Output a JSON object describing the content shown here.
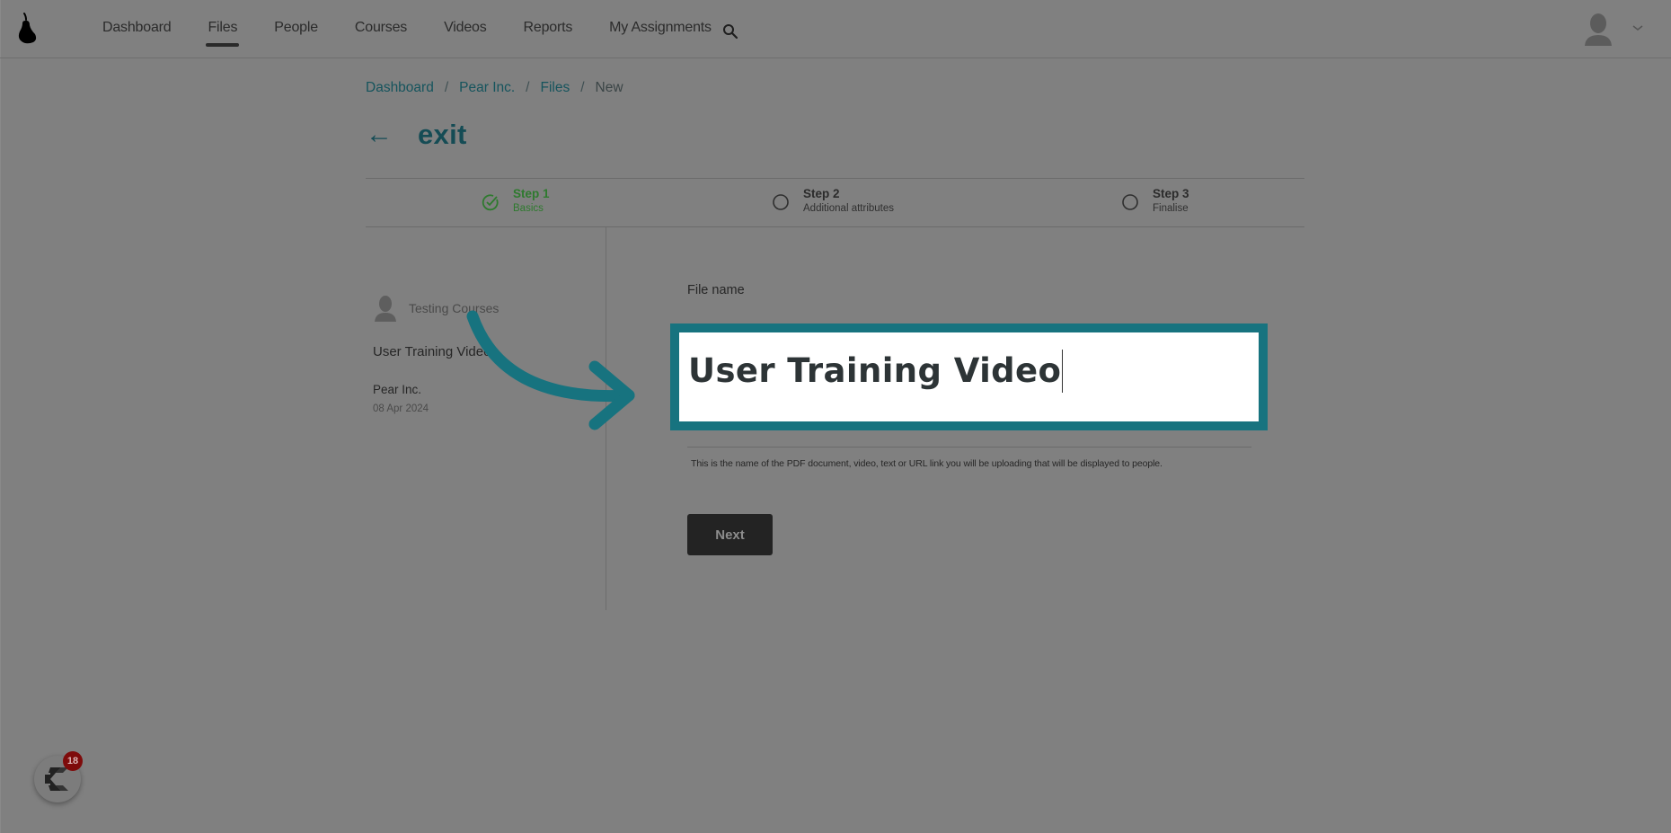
{
  "header": {
    "logo": "pear-logo-icon",
    "nav": [
      {
        "label": "Dashboard",
        "active": false
      },
      {
        "label": "Files",
        "active": true
      },
      {
        "label": "People",
        "active": false
      },
      {
        "label": "Courses",
        "active": false
      },
      {
        "label": "Videos",
        "active": false
      },
      {
        "label": "Reports",
        "active": false
      },
      {
        "label": "My Assignments",
        "active": false
      }
    ],
    "search_icon": "search-icon",
    "user_menu_icon": "chevron-down-icon"
  },
  "breadcrumb": {
    "items": [
      "Dashboard",
      "Pear Inc.",
      "Files"
    ],
    "separator": "/",
    "current": "New"
  },
  "exit": {
    "arrow": "←",
    "label": "exit"
  },
  "stepper": {
    "steps": [
      {
        "title": "Step 1",
        "subtitle": "Basics",
        "status": "complete"
      },
      {
        "title": "Step 2",
        "subtitle": "Additional attributes",
        "status": "pending"
      },
      {
        "title": "Step 3",
        "subtitle": "Finalise",
        "status": "pending"
      }
    ],
    "complete_color": "#2e7a2e"
  },
  "sidebar": {
    "owner": "Testing Courses",
    "file_title": "User Training Video",
    "organization": "Pear Inc.",
    "date": "08 Apr 2024"
  },
  "form": {
    "file_name_label": "File name",
    "file_name_value": "User Training Video",
    "help_text": "This is the name of the PDF document, video, text or URL link you will be uploading that will be displayed to people.",
    "next_label": "Next"
  },
  "annotation": {
    "highlight_color": "#17737f",
    "arrow": "curved-arrow-icon"
  },
  "chat_widget": {
    "badge_count": "18"
  }
}
